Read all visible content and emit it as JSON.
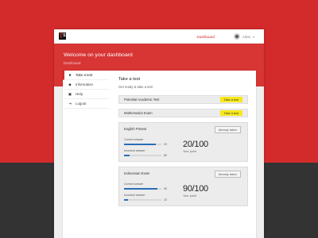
{
  "colors": {
    "brand_red": "#d32b2b",
    "accent_yellow": "#f7e81b",
    "bar_blue": "#2a6db5"
  },
  "topbar": {
    "logo_t": "T",
    "logo_s": "S",
    "nav_dashboard": "Dashboard",
    "user_name": "Atlas",
    "user_chevron": "▾"
  },
  "hero": {
    "title": "Welcome on your dashboard",
    "breadcrumb": "Dashboard"
  },
  "sidebar": {
    "items": [
      {
        "icon": "■",
        "icon_name": "home-icon",
        "label": "Take a test"
      },
      {
        "icon": "◆",
        "icon_name": "info-icon",
        "label": "Information"
      },
      {
        "icon": "▣",
        "icon_name": "help-icon",
        "label": "Help"
      },
      {
        "icon": "⇥",
        "icon_name": "logout-icon",
        "label": "Logout"
      }
    ]
  },
  "main": {
    "title": "Take a test",
    "subtitle": "Get ready & take a test",
    "tests": [
      {
        "name": "Potential Academic Test",
        "button": "Take a test"
      },
      {
        "name": "Mathematics Exam",
        "button": "Take a test"
      }
    ],
    "results": [
      {
        "name": "English Pretest",
        "badge": "Already taken",
        "correct_label": "Correct answer",
        "correct_value": "20",
        "correct_fraction": 0.85,
        "incorrect_label": "Incorrect answer",
        "incorrect_value": "80",
        "incorrect_fraction": 0.15,
        "score": "20/100",
        "points_label": "Your point"
      },
      {
        "name": "Indonesian Exam",
        "badge": "Already taken",
        "correct_label": "Correct answer",
        "correct_value": "90",
        "correct_fraction": 0.9,
        "incorrect_label": "Incorrect answer",
        "incorrect_value": "10",
        "incorrect_fraction": 0.1,
        "score": "90/100",
        "points_label": "Your point"
      }
    ]
  }
}
